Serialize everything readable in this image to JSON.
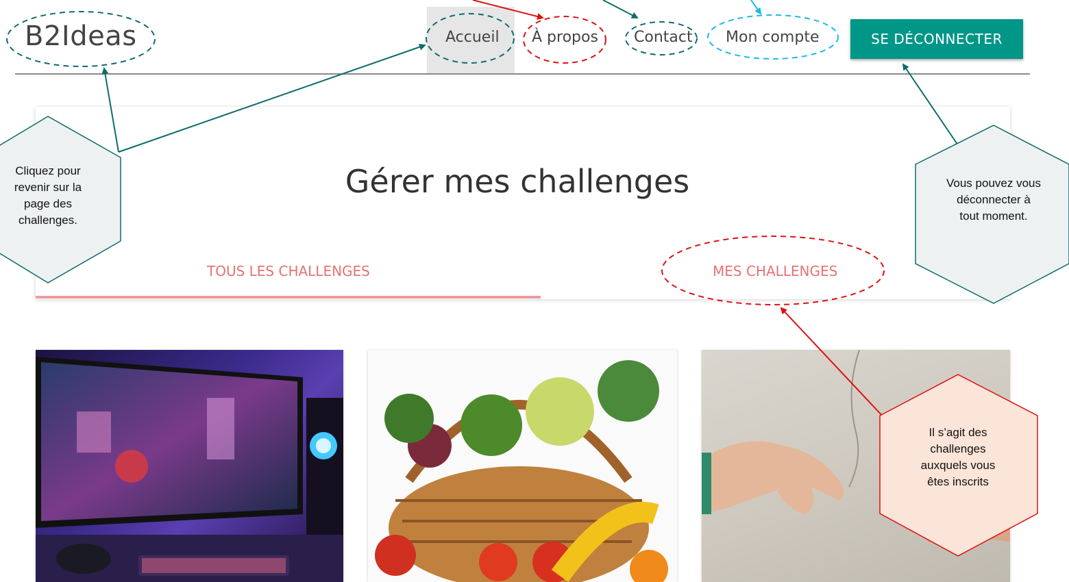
{
  "header": {
    "logo": "B2Ideas",
    "nav": [
      "Accueil",
      "À propos",
      "Contact",
      "Mon compte"
    ],
    "logout_label": "SE DÉCONNECTER"
  },
  "main": {
    "title": "Gérer mes challenges",
    "tabs": [
      {
        "label": "TOUS LES CHALLENGES",
        "active": true
      },
      {
        "label": "MES CHALLENGES",
        "active": false
      }
    ]
  },
  "cards": [
    {
      "icon": "gaming-setup-image"
    },
    {
      "icon": "vegetable-basket-image"
    },
    {
      "icon": "creation-of-adam-hands-image"
    }
  ],
  "annotations": {
    "home": "Cliquez pour revenir sur la page des challenges.",
    "logout": "Vous pouvez vous déconnecter à tout moment.",
    "my_challenges": "Il s’agit des challenges auxquels vous êtes inscrits"
  },
  "colors": {
    "accent": "#009688",
    "tab_text": "#e57373",
    "annotation_teal": "#0d6b6b",
    "annotation_red": "#e01010",
    "annotation_cyan": "#1ab8e8",
    "callout_fill_grey": "#eef1f2",
    "callout_fill_pink": "#fbe4d8"
  }
}
